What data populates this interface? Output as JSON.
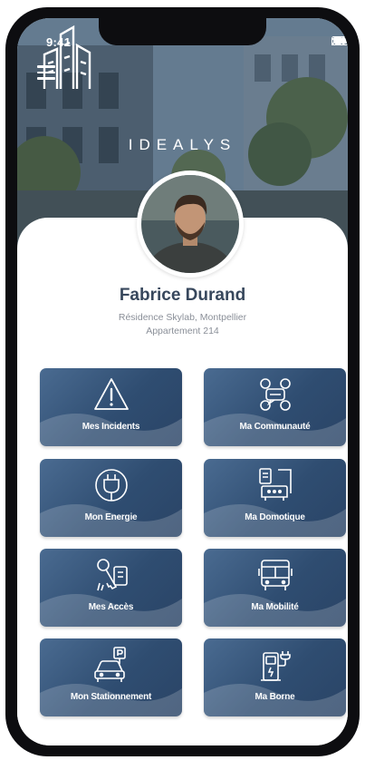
{
  "status_bar": {
    "time": "9:41"
  },
  "header": {
    "brand": "IDEALYS"
  },
  "profile": {
    "name": "Fabrice Durand",
    "address_line1": "Résidence Skylab, Montpellier",
    "address_line2": "Appartement 214"
  },
  "tiles": [
    {
      "label": "Mes Incidents",
      "icon": "warning-icon"
    },
    {
      "label": "Ma Communauté",
      "icon": "community-icon"
    },
    {
      "label": "Mon Energie",
      "icon": "plug-icon"
    },
    {
      "label": "Ma Domotique",
      "icon": "smart-home-icon"
    },
    {
      "label": "Mes Accès",
      "icon": "keys-icon"
    },
    {
      "label": "Ma Mobilité",
      "icon": "bus-icon"
    },
    {
      "label": "Mon Stationnement",
      "icon": "parking-car-icon"
    },
    {
      "label": "Ma Borne",
      "icon": "charging-station-icon"
    }
  ],
  "colors": {
    "tile": "#2f4d71",
    "name": "#37475c"
  }
}
